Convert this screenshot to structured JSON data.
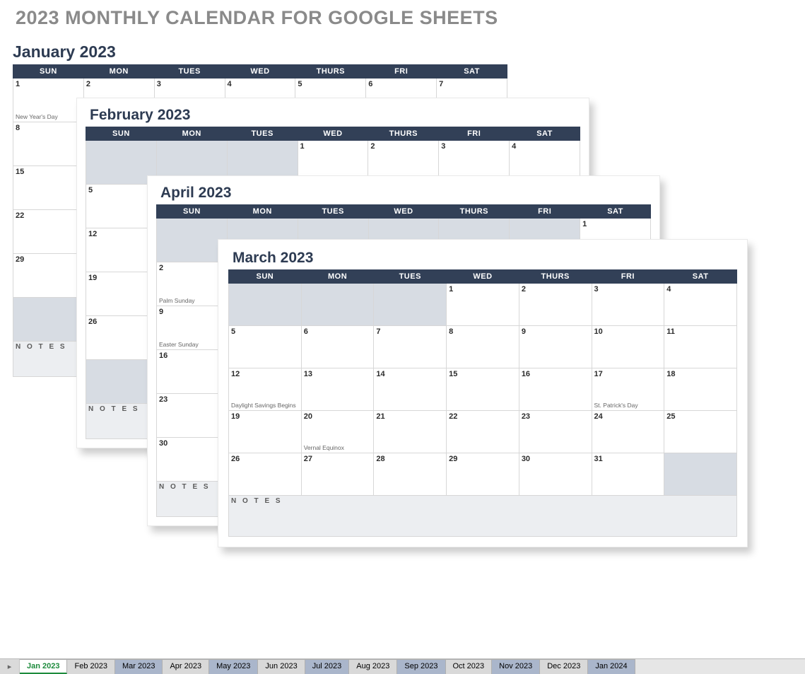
{
  "title": "2023 MONTHLY CALENDAR FOR GOOGLE SHEETS",
  "dayHeaders": [
    "SUN",
    "MON",
    "TUES",
    "WED",
    "THURS",
    "FRI",
    "SAT"
  ],
  "notesLabel": "N O T E S",
  "months": {
    "jan": {
      "title": "January 2023",
      "startPad": 0,
      "days": 31,
      "events": {
        "1": "New Year's Day"
      }
    },
    "feb": {
      "title": "February 2023",
      "startPad": 3,
      "days": 28,
      "events": {}
    },
    "apr": {
      "title": "April 2023",
      "startPad": 6,
      "days": 30,
      "events": {
        "2": "Palm Sunday",
        "9": "Easter Sunday"
      }
    },
    "mar": {
      "title": "March 2023",
      "startPad": 3,
      "days": 31,
      "events": {
        "12": "Daylight Savings Begins",
        "17": "St. Patrick's Day",
        "20": "Vernal Equinox"
      }
    }
  },
  "tabs": [
    {
      "label": "Jan 2023",
      "active": true,
      "alt": false
    },
    {
      "label": "Feb 2023",
      "active": false,
      "alt": false
    },
    {
      "label": "Mar 2023",
      "active": false,
      "alt": true
    },
    {
      "label": "Apr 2023",
      "active": false,
      "alt": false
    },
    {
      "label": "May 2023",
      "active": false,
      "alt": true
    },
    {
      "label": "Jun 2023",
      "active": false,
      "alt": false
    },
    {
      "label": "Jul 2023",
      "active": false,
      "alt": true
    },
    {
      "label": "Aug 2023",
      "active": false,
      "alt": false
    },
    {
      "label": "Sep 2023",
      "active": false,
      "alt": true
    },
    {
      "label": "Oct 2023",
      "active": false,
      "alt": false
    },
    {
      "label": "Nov 2023",
      "active": false,
      "alt": true
    },
    {
      "label": "Dec 2023",
      "active": false,
      "alt": false
    },
    {
      "label": "Jan 2024",
      "active": false,
      "alt": true
    }
  ]
}
